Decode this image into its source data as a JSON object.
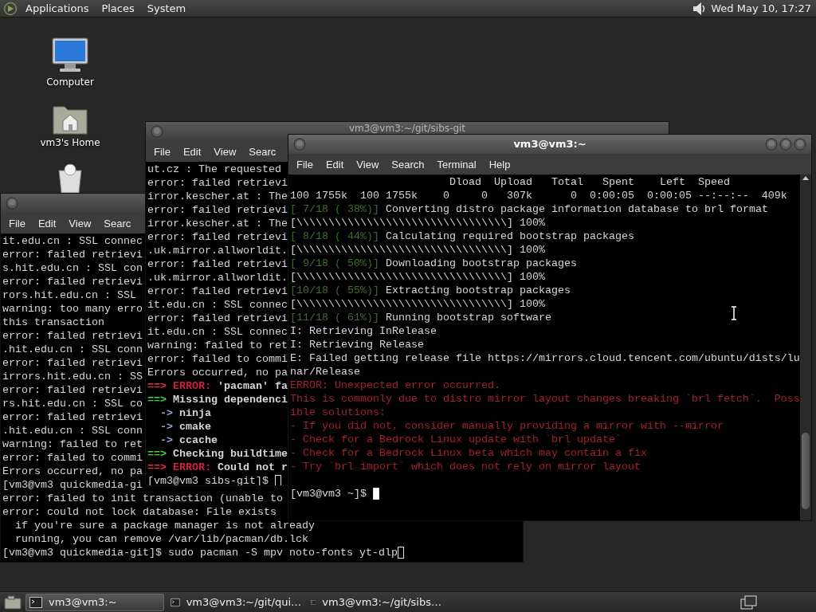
{
  "top_panel": {
    "menus": [
      "Applications",
      "Places",
      "System"
    ],
    "clock": "Wed May 10, 17:27"
  },
  "desktop_icons": [
    {
      "kind": "computer",
      "label": "Computer"
    },
    {
      "kind": "home",
      "label": "vm3's Home"
    },
    {
      "kind": "trash"
    }
  ],
  "windows": [
    {
      "active": false,
      "menu": [
        "File",
        "Edit",
        "View",
        "Searc"
      ],
      "lines": [
        "it.edu.cn : SSL connec",
        "error: failed retrievi",
        "s.hit.edu.cn : SSL con",
        "error: failed retrievi",
        "rors.hit.edu.cn : SSL",
        "warning: too many erro",
        "this transaction",
        "error: failed retrievi",
        ".hit.edu.cn : SSL conn",
        "error: failed retrievi",
        "irrors.hit.edu.cn : SS",
        "error: failed retrievi",
        "rs.hit.edu.cn : SSL co",
        "error: failed retrievi",
        ".hit.edu.cn : SSL conn",
        "warning: failed to ret",
        "error: failed to commi",
        "Errors occurred, no pa",
        "[vm3@vm3 quickmedia-gi",
        "error: failed to init transaction (unable to",
        "error: could not lock database: File exists",
        "  if you're sure a package manager is not already",
        "  running, you can remove /var/lib/pacman/db.lck"
      ],
      "prompt": {
        "text": "[vm3@vm3 quickmedia-git]$ sudo pacman -S mpv noto-fonts yt-dlp",
        "focused": false,
        "gap": false
      }
    },
    {
      "title": "vm3@vm3:~/git/sibs-git",
      "active": false,
      "menu": [
        "File",
        "Edit",
        "View",
        "Searc"
      ],
      "lines": [
        "ut.cz : The requested",
        "error: failed retrievi",
        "irror.kescher.at : The",
        "error: failed retrievi",
        "irror.kescher.at : The",
        "error: failed retrievi",
        ".uk.mirror.allworldit.",
        "error: failed retrievi",
        ".uk.mirror.allworldit.",
        "error: failed retrievi",
        "it.edu.cn : SSL connec",
        "error: failed retrievi",
        "it.edu.cn : SSL connec",
        "warning: failed to ret",
        "error: failed to commi",
        "Errors occurred, no pa",
        {
          "segments": [
            {
              "text": "==> ",
              "color": "#e8324a",
              "bold": true
            },
            {
              "text": "ERROR:",
              "color": "#d0203a",
              "bold": true
            },
            {
              "text": " 'pacman' fa",
              "bold": true
            }
          ]
        },
        {
          "segments": [
            {
              "text": "==> ",
              "color": "#46d246",
              "bold": true
            },
            {
              "text": "Missing dependenci",
              "bold": true
            }
          ]
        },
        {
          "segments": [
            {
              "text": "  -> ",
              "color": "#8fa8d8",
              "bold": true
            },
            {
              "text": "ninja",
              "bold": true
            }
          ]
        },
        {
          "segments": [
            {
              "text": "  -> ",
              "color": "#8fa8d8",
              "bold": true
            },
            {
              "text": "cmake",
              "bold": true
            }
          ]
        },
        {
          "segments": [
            {
              "text": "  -> ",
              "color": "#8fa8d8",
              "bold": true
            },
            {
              "text": "ccache",
              "bold": true
            }
          ]
        },
        {
          "segments": [
            {
              "text": "==> ",
              "color": "#46d246",
              "bold": true
            },
            {
              "text": "Checking buildtime",
              "bold": true
            }
          ]
        },
        {
          "segments": [
            {
              "text": "==> ",
              "color": "#e8324a",
              "bold": true
            },
            {
              "text": "ERROR:",
              "color": "#d0203a",
              "bold": true
            },
            {
              "text": " Could not r",
              "bold": true
            }
          ]
        }
      ],
      "prompt": {
        "text": "[vm3@vm3 sibs-git]$ ",
        "focused": false,
        "gap": false
      }
    },
    {
      "title": "vm3@vm3:~",
      "active": true,
      "menu": [
        "File",
        "Edit",
        "View",
        "Search",
        "Terminal",
        "Help"
      ],
      "lines": [
        "                         Dload  Upload   Total   Spent    Left  Speed",
        "100 1755k  100 1755k    0     0   307k      0  0:00:05  0:00:05 --:--:--  409k",
        {
          "segments": [
            {
              "text": "[ 7/18 ( 38%)]",
              "color": "#3f6e2e"
            },
            {
              "text": " Converting distro package information database to brl format"
            }
          ]
        },
        "[\\\\\\\\\\\\\\\\\\\\\\\\\\\\\\\\\\\\\\\\\\\\\\\\\\\\\\\\\\\\\\\\\\] 100%",
        {
          "segments": [
            {
              "text": "[ 8/18 ( 44%)]",
              "color": "#3f6e2e"
            },
            {
              "text": " Calculating required bootstrap packages"
            }
          ]
        },
        "[\\\\\\\\\\\\\\\\\\\\\\\\\\\\\\\\\\\\\\\\\\\\\\\\\\\\\\\\\\\\\\\\\\] 100%",
        {
          "segments": [
            {
              "text": "[ 9/18 ( 50%)]",
              "color": "#3f6e2e"
            },
            {
              "text": " Downloading bootstrap packages"
            }
          ]
        },
        "[\\\\\\\\\\\\\\\\\\\\\\\\\\\\\\\\\\\\\\\\\\\\\\\\\\\\\\\\\\\\\\\\\\] 100%",
        {
          "segments": [
            {
              "text": "[10/18 ( 55%)]",
              "color": "#3f6e2e"
            },
            {
              "text": " Extracting bootstrap packages"
            }
          ]
        },
        "[\\\\\\\\\\\\\\\\\\\\\\\\\\\\\\\\\\\\\\\\\\\\\\\\\\\\\\\\\\\\\\\\\\] 100%",
        {
          "segments": [
            {
              "text": "[11/18 ( 61%)]",
              "color": "#3f6e2e"
            },
            {
              "text": " Running bootstrap software"
            }
          ]
        },
        "I: Retrieving InRelease",
        "I: Retrieving Release",
        "E: Failed getting release file https://mirrors.cloud.tencent.com/ubuntu/dists/lu",
        "nar/Release",
        {
          "segments": [
            {
              "text": "ERROR: Unexpected error occurred.",
              "color": "#a3202e"
            }
          ]
        },
        {
          "segments": [
            {
              "text": "This is commonly due to distro mirror layout changes breaking `brl fetch`.  Poss",
              "color": "#a3202e"
            }
          ]
        },
        {
          "segments": [
            {
              "text": "ible solutions:",
              "color": "#a3202e"
            }
          ]
        },
        {
          "segments": [
            {
              "text": "- If you did not, consider manually providing a mirror with --mirror",
              "color": "#a3202e"
            }
          ]
        },
        {
          "segments": [
            {
              "text": "- Check for a Bedrock Linux update with `brl update`",
              "color": "#a3202e"
            }
          ]
        },
        {
          "segments": [
            {
              "text": "- Check for a Bedrock Linux beta which may contain a fix",
              "color": "#a3202e"
            }
          ]
        },
        {
          "segments": [
            {
              "text": "- Try `brl import` which does not rely on mirror layout",
              "color": "#a3202e"
            }
          ]
        }
      ],
      "prompt": {
        "text": "[vm3@vm3 ~]$ ",
        "focused": true,
        "gap": true
      }
    }
  ],
  "taskbar": {
    "tasks": [
      {
        "label": "vm3@vm3:~",
        "selected": true
      },
      {
        "label": "vm3@vm3:~/git/qui…",
        "selected": false
      },
      {
        "label": "vm3@vm3:~/git/sibs…",
        "selected": false
      }
    ]
  }
}
